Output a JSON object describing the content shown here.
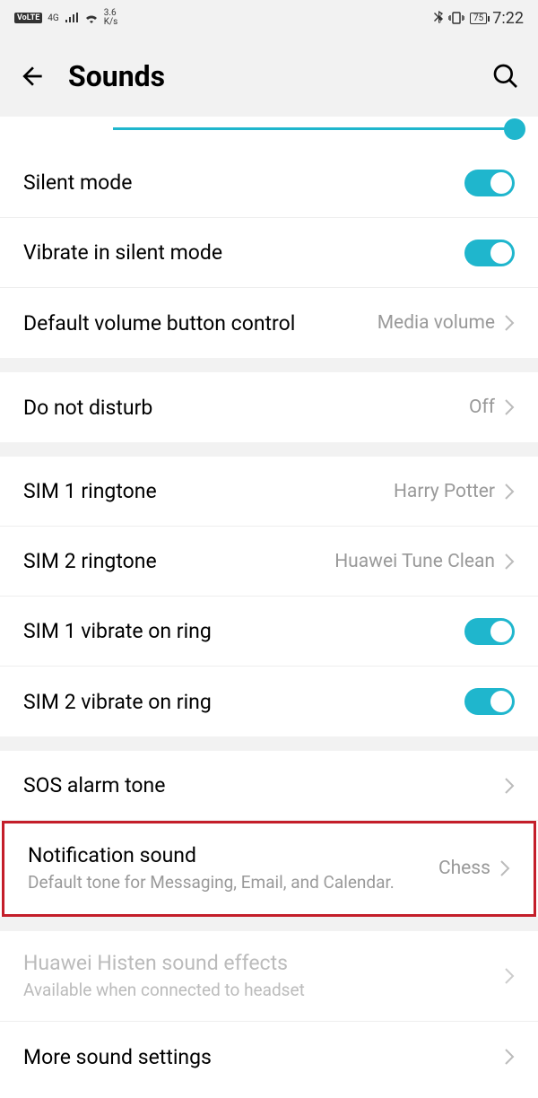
{
  "status": {
    "volte": "VoLTE",
    "net_label": "4G",
    "speed_top": "3.6",
    "speed_bot": "K/s",
    "battery": "75",
    "time": "7:22"
  },
  "header": {
    "title": "Sounds"
  },
  "rows": {
    "silent_mode": {
      "title": "Silent mode"
    },
    "vibrate_silent": {
      "title": "Vibrate in silent mode"
    },
    "default_volume": {
      "title": "Default volume button control",
      "value": "Media volume"
    },
    "dnd": {
      "title": "Do not disturb",
      "value": "Off"
    },
    "sim1_ringtone": {
      "title": "SIM 1 ringtone",
      "value": "Harry Potter"
    },
    "sim2_ringtone": {
      "title": "SIM 2 ringtone",
      "value": "Huawei Tune Clean"
    },
    "sim1_vibrate": {
      "title": "SIM 1 vibrate on ring"
    },
    "sim2_vibrate": {
      "title": "SIM 2 vibrate on ring"
    },
    "sos": {
      "title": "SOS alarm tone"
    },
    "notification": {
      "title": "Notification sound",
      "sub": "Default tone for Messaging, Email, and Calendar.",
      "value": "Chess"
    },
    "histen": {
      "title": "Huawei Histen sound effects",
      "sub": "Available when connected to headset"
    },
    "more": {
      "title": "More sound settings"
    }
  }
}
